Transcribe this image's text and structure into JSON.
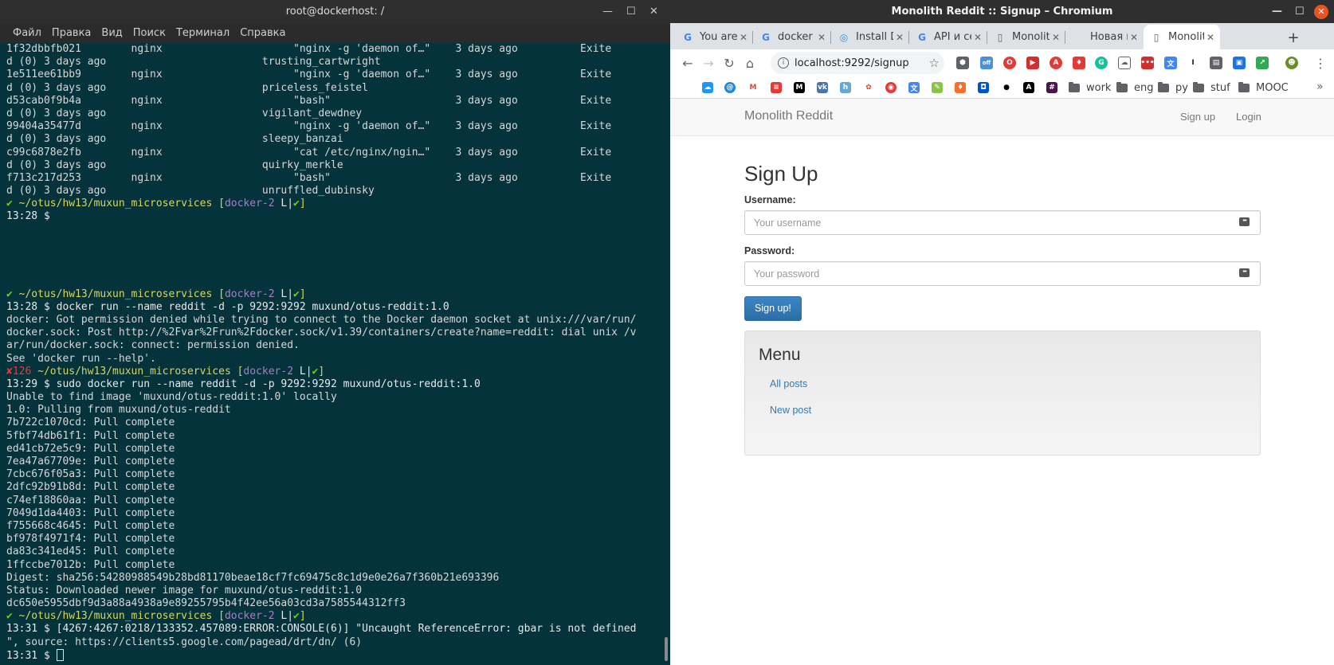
{
  "terminal": {
    "title": "root@dockerhost: /",
    "menu": [
      "Файл",
      "Правка",
      "Вид",
      "Поиск",
      "Терминал",
      "Справка"
    ],
    "ps_rows": [
      {
        "id": "1f32dbbfb021",
        "image": "nginx",
        "command": "\"nginx -g 'daemon of…\"",
        "created": "3 days ago",
        "status": "Exite",
        "wrap": "d (0) 3 days ago",
        "name": "trusting_cartwright"
      },
      {
        "id": "1e511ee61bb9",
        "image": "nginx",
        "command": "\"nginx -g 'daemon of…\"",
        "created": "3 days ago",
        "status": "Exite",
        "wrap": "d (0) 3 days ago",
        "name": "priceless_feistel"
      },
      {
        "id": "d53cab0f9b4a",
        "image": "nginx",
        "command": "\"bash\"",
        "created": "3 days ago",
        "status": "Exite",
        "wrap": "d (0) 3 days ago",
        "name": "vigilant_dewdney"
      },
      {
        "id": "99404a35477d",
        "image": "nginx",
        "command": "\"nginx -g 'daemon of…\"",
        "created": "3 days ago",
        "status": "Exite",
        "wrap": "d (0) 3 days ago",
        "name": "sleepy_banzai"
      },
      {
        "id": "c99c6878e2fb",
        "image": "nginx",
        "command": "\"cat /etc/nginx/ngin…\"",
        "created": "3 days ago",
        "status": "Exite",
        "wrap": "d (0) 3 days ago",
        "name": "quirky_merkle"
      },
      {
        "id": "f713c217d253",
        "image": "nginx",
        "command": "\"bash\"",
        "created": "3 days ago",
        "status": "Exite",
        "wrap": "d (0) 3 days ago",
        "name": "unruffled_dubinsky"
      }
    ],
    "prompt_path": "~/otus/hw13/muxun_microservices",
    "prompt_branch": "docker-2",
    "prompt_flags": "L|",
    "check": "✔",
    "cross": "✘",
    "exit_code": "126",
    "t1": "13:28",
    "t2": "13:28",
    "cmd1": "docker run --name reddit -d -p 9292:9292 muxund/otus-reddit:1.0",
    "err1": "docker: Got permission denied while trying to connect to the Docker daemon socket at unix:///var/run/",
    "err2": "docker.sock: Post http://%2Fvar%2Frun%2Fdocker.sock/v1.39/containers/create?name=reddit: dial unix /v",
    "err3": "ar/run/docker.sock: connect: permission denied.",
    "err4": "See 'docker run --help'.",
    "t3": "13:29",
    "cmd2": "sudo docker run --name reddit -d -p 9292:9292 muxund/otus-reddit:1.0",
    "unable": "Unable to find image 'muxund/otus-reddit:1.0' locally",
    "pulling": "1.0: Pulling from muxund/otus-reddit",
    "layers": [
      "7b722c1070cd",
      "5fbf74db61f1",
      "ed41cb72e5c9",
      "7ea47a67709e",
      "7cbc676f05a3",
      "2dfc92b91b8d",
      "c74ef18860aa",
      "7049d1da4403",
      "f755668c4645",
      "bf978f4971f4",
      "da83c341ed45",
      "1ffccbe7012b"
    ],
    "pull_complete": "Pull complete",
    "digest": "Digest: sha256:54280988549b28bd81170beae18cf7fc69475c8c1d9e0e26a7f360b21e693396",
    "status": "Status: Downloaded newer image for muxund/otus-reddit:1.0",
    "container_id": "dc650e5955dbf9d3a88a4938a9e89255795b4f42ee56a03cd3a7585544312ff3",
    "t4": "13:31",
    "console_err1": "[4267:4267:0218/133352.457089:ERROR:CONSOLE(6)] \"Uncaught ReferenceError: gbar is not defined",
    "console_err2": "\", source: https://clients5.google.com/pagead/drt/dn/ (6)",
    "t5": "13:31"
  },
  "browser": {
    "title": "Monolith Reddit :: Signup – Chromium",
    "tabs": [
      {
        "label": "You are",
        "favicon": "G",
        "color": "#4285f4"
      },
      {
        "label": "docker r",
        "favicon": "G",
        "color": "#4285f4"
      },
      {
        "label": "Install D",
        "favicon": "◎",
        "color": "#2496ed"
      },
      {
        "label": "API и се",
        "favicon": "G",
        "color": "#4285f4"
      },
      {
        "label": "Monolit",
        "favicon": "▯",
        "color": "#5f6368"
      },
      {
        "label": "Новая вкла",
        "favicon": "",
        "color": "#5f6368"
      },
      {
        "label": "Monolit",
        "favicon": "▯",
        "color": "#5f6368"
      }
    ],
    "url": "localhost:9292/signup",
    "extension_badge": "off",
    "bookmark_folders": [
      "work",
      "eng",
      "py",
      "stuf",
      "MOOC"
    ],
    "page": {
      "brand": "Monolith Reddit",
      "nav_signup": "Sign up",
      "nav_login": "Login",
      "heading": "Sign Up",
      "username_label": "Username:",
      "username_placeholder": "Your username",
      "password_label": "Password:",
      "password_placeholder": "Your password",
      "submit": "Sign up!",
      "menu_title": "Menu",
      "menu_all_posts": "All posts",
      "menu_new_post": "New post"
    }
  }
}
